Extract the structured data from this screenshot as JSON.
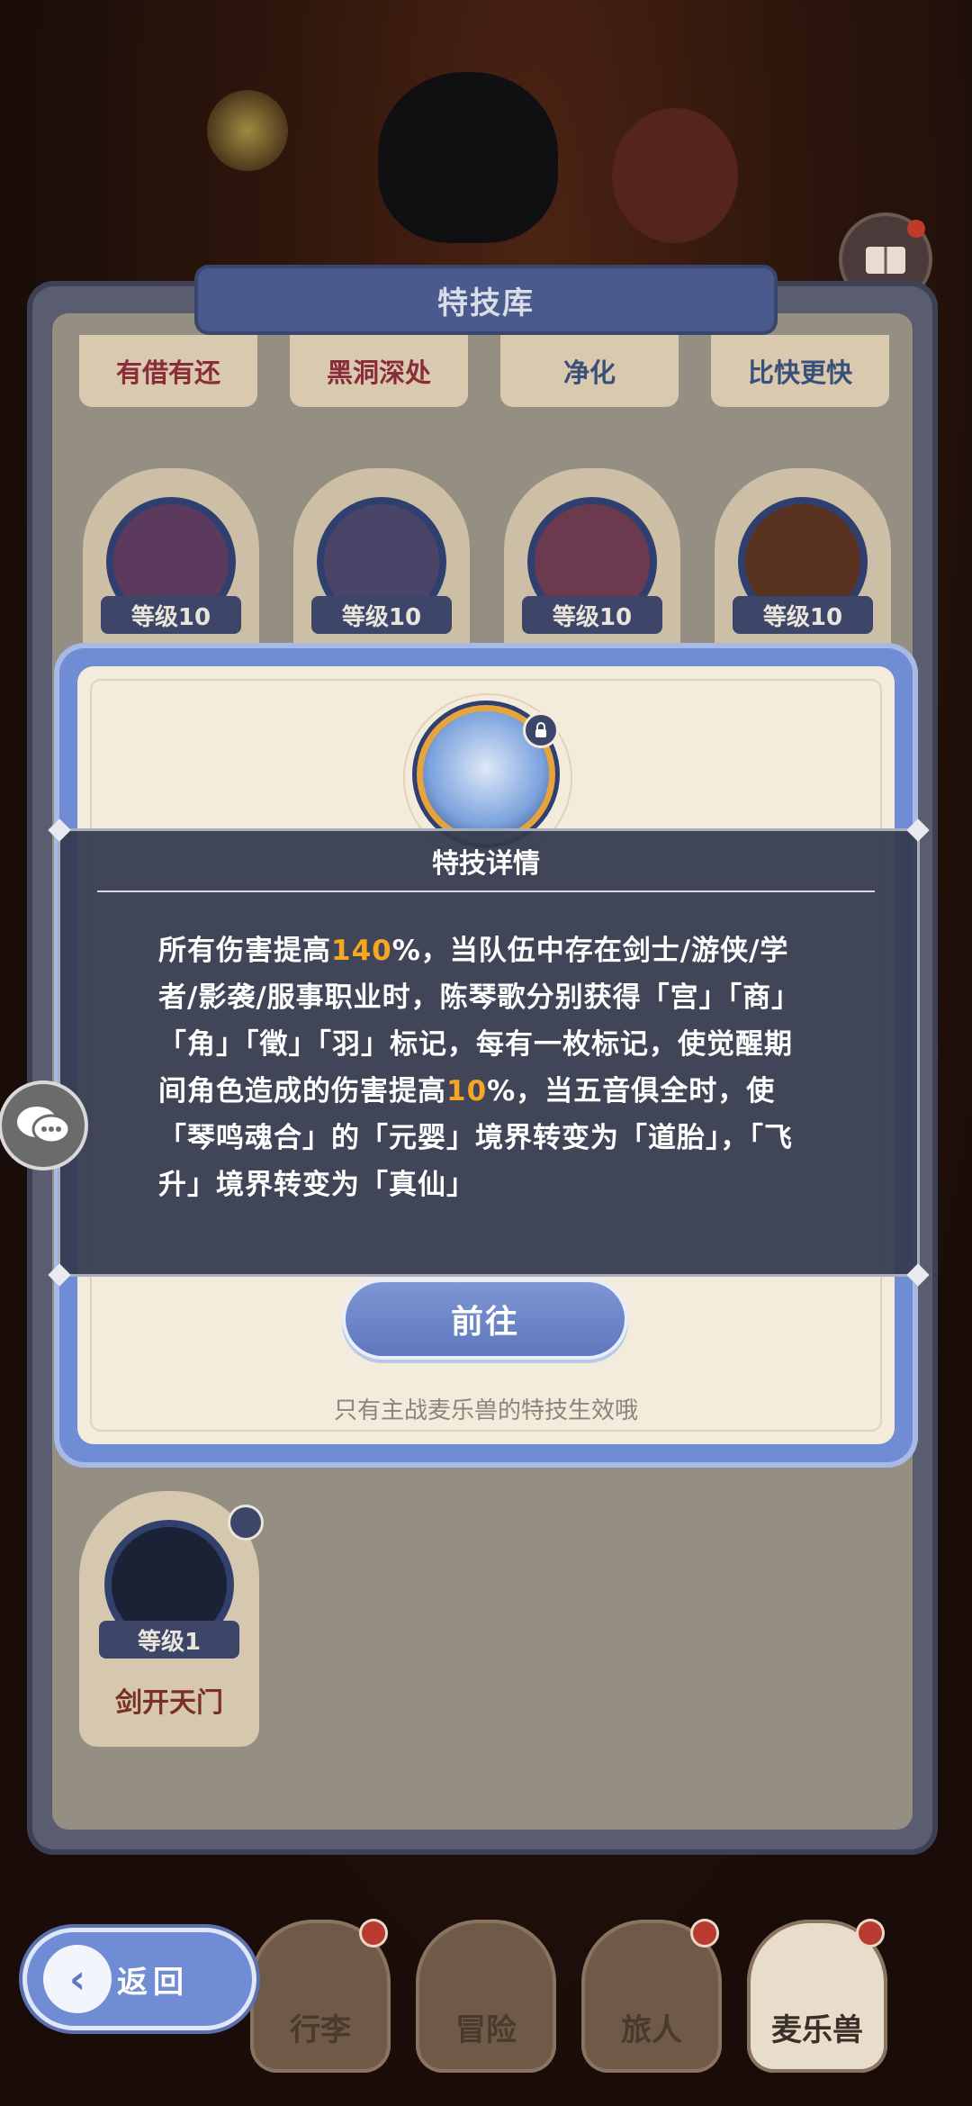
{
  "library": {
    "title": "特技库",
    "tabs": [
      "有借有还",
      "黑洞深处",
      "净化",
      "比快更快"
    ],
    "cards": [
      {
        "level": "等级10",
        "color": "#5b3a5e"
      },
      {
        "level": "等级10",
        "color": "#4a4468"
      },
      {
        "level": "等级10",
        "color": "#6b3a4e"
      },
      {
        "level": "等级10",
        "color": "#5a3222"
      }
    ],
    "owned": {
      "level": "等级1",
      "name": "剑开天门"
    }
  },
  "modal": {
    "go_button": "前往",
    "note": "只有主战麦乐兽的特技生效哦"
  },
  "tooltip": {
    "title": "特技详情",
    "body_parts": [
      {
        "text": "所有伤害提高",
        "hl": false
      },
      {
        "text": "140",
        "hl": true
      },
      {
        "text": "%，当队伍中存在剑士/游侠/学者/影袭/服事职业时，陈琴歌分别获得「宫」「商」「角」「徵」「羽」标记，每有一枚标记，使觉醒期间角色造成的伤害提高",
        "hl": false
      },
      {
        "text": "10",
        "hl": true
      },
      {
        "text": "%，当五音俱全时，使「琴鸣魂合」的「元婴」境界转变为「道胎」，「飞升」境界转变为「真仙」",
        "hl": false
      }
    ],
    "highlight_color": "#f5a623"
  },
  "nav": {
    "back_label": "返回",
    "items": [
      "行李",
      "冒险",
      "旅人",
      "麦乐兽"
    ]
  },
  "icons": {
    "chat": "chat-bubbles-icon",
    "back": "back-arrow-icon",
    "lock": "lock-icon",
    "book": "book-icon"
  }
}
